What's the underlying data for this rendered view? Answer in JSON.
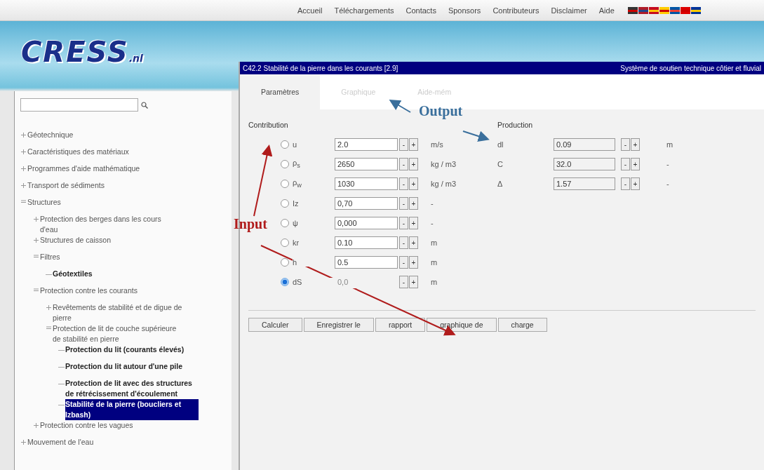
{
  "nav": [
    "Accueil",
    "Téléchargements",
    "Contacts",
    "Sponsors",
    "Contributeurs",
    "Disclaimer",
    "Aide"
  ],
  "logo": {
    "name": "CRESS",
    "suffix": ".nl"
  },
  "tree": [
    {
      "label": "Géotechnique",
      "kind": "folder",
      "expanded": false,
      "selected": false
    },
    {
      "label": "Caractéristiques des matériaux",
      "kind": "folder",
      "expanded": false,
      "selected": false
    },
    {
      "label": "Programmes d'aide mathématique",
      "kind": "folder",
      "expanded": false,
      "selected": false
    },
    {
      "label": "Transport de sédiments",
      "kind": "folder",
      "expanded": false,
      "selected": false
    },
    {
      "label": "Structures",
      "kind": "folder",
      "expanded": true,
      "selected": false,
      "children": [
        {
          "label": "Protection des berges dans les cours d'eau",
          "kind": "folder",
          "expanded": false,
          "selected": false
        },
        {
          "label": "Structures de caisson",
          "kind": "folder",
          "expanded": false,
          "selected": false
        },
        {
          "label": "Filtres",
          "kind": "folder",
          "expanded": true,
          "selected": false,
          "children": [
            {
              "label": "Géotextiles",
              "kind": "leaf",
              "selected": false
            }
          ]
        },
        {
          "label": "Protection contre les courants",
          "kind": "folder",
          "expanded": true,
          "selected": false,
          "children": [
            {
              "label": "Revêtements de stabilité et de digue de pierre",
              "kind": "folder",
              "expanded": false,
              "selected": false
            },
            {
              "label": "Protection de lit de couche supérieure de stabilité en pierre",
              "kind": "folder",
              "expanded": true,
              "selected": false,
              "children": [
                {
                  "label": "Protection du lit (courants élevés)",
                  "kind": "leaf",
                  "selected": false
                },
                {
                  "label": "Protection du lit autour d'une pile",
                  "kind": "leaf",
                  "selected": false
                },
                {
                  "label": "Protection de lit avec des structures de rétrécissement d'écoulement",
                  "kind": "leaf",
                  "selected": false
                },
                {
                  "label": "Stabilité de la pierre (boucliers et Izbash)",
                  "kind": "leaf",
                  "selected": true
                }
              ]
            }
          ]
        },
        {
          "label": "Protection contre les vagues",
          "kind": "folder",
          "expanded": false,
          "selected": false
        }
      ]
    },
    {
      "label": "Mouvement de l'eau",
      "kind": "folder",
      "expanded": false,
      "selected": false
    }
  ],
  "dialog": {
    "title": "C42.2 Stabilité de la pierre dans les courants [2.9]",
    "subtitle": "Système de soutien technique côtier et fluvial"
  },
  "tabs": [
    {
      "label": "Paramètres",
      "selected": true
    },
    {
      "label": "Graphique",
      "selected": false
    },
    {
      "label": "Aide-mém",
      "selected": false
    }
  ],
  "inputs_title": "Contribution",
  "inputs": [
    {
      "symbol": "u",
      "value": "2.0",
      "unit": "m/s",
      "selected": false,
      "disabled": false
    },
    {
      "symbol": "ρ$_{s}$",
      "value": "2650",
      "unit": "kg / m3",
      "selected": false,
      "disabled": false
    },
    {
      "symbol": "ρ$_{w}$",
      "value": "1030",
      "unit": "kg / m3",
      "selected": false,
      "disabled": false
    },
    {
      "symbol": "Iz",
      "value": "0,70",
      "unit": "-",
      "selected": false,
      "disabled": false
    },
    {
      "symbol": "ψ",
      "value": "0,000",
      "unit": "-",
      "selected": false,
      "disabled": false
    },
    {
      "symbol": "kr",
      "value": "0.10",
      "unit": "m",
      "selected": false,
      "disabled": false
    },
    {
      "symbol": "h",
      "value": "0.5",
      "unit": "m",
      "selected": false,
      "disabled": false
    },
    {
      "symbol": "dS",
      "value": "0,0",
      "unit": "m",
      "selected": true,
      "disabled": true
    }
  ],
  "outputs_title": "Production",
  "outputs": [
    {
      "symbol": "dl",
      "value": "0.09",
      "unit": "m"
    },
    {
      "symbol": "C",
      "value": "32.0",
      "unit": "-"
    },
    {
      "symbol": "Δ",
      "value": "1.57",
      "unit": "-"
    }
  ],
  "stepper": {
    "minus": "-",
    "plus": "+"
  },
  "buttons": [
    "Calculer",
    "Enregistrer le",
    "rapport",
    "graphique de",
    "charge"
  ],
  "annotations": [
    {
      "label": "Input",
      "color": "#b01c1c"
    },
    {
      "label": "Output",
      "color": "#3a6f9c"
    }
  ]
}
